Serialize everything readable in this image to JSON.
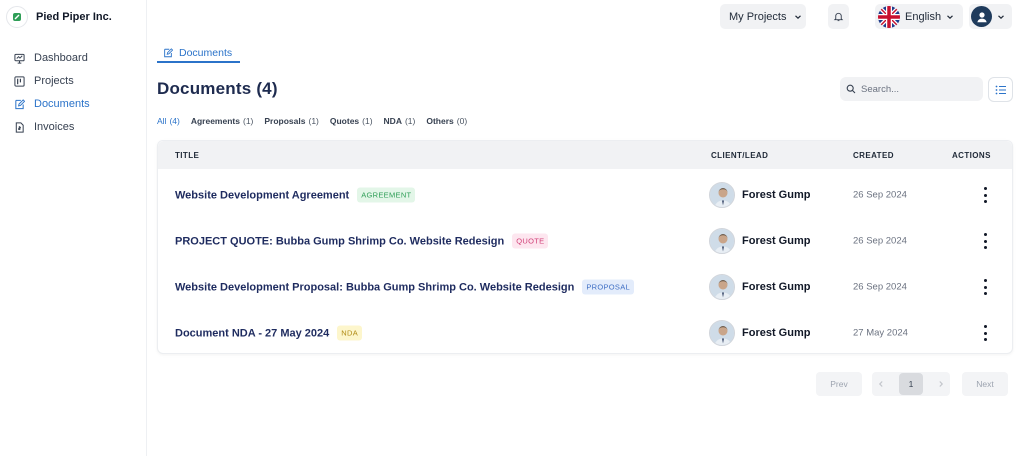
{
  "brand": {
    "name": "Pied Piper Inc."
  },
  "nav": [
    {
      "label": "Dashboard",
      "icon": "dashboard-icon"
    },
    {
      "label": "Projects",
      "icon": "projects-icon"
    },
    {
      "label": "Documents",
      "icon": "documents-icon",
      "active": true
    },
    {
      "label": "Invoices",
      "icon": "invoices-icon"
    }
  ],
  "header": {
    "projects_label": "My Projects",
    "language": "English"
  },
  "tab": {
    "label": "Documents"
  },
  "page": {
    "title": "Documents",
    "count": "(4)"
  },
  "search": {
    "placeholder": "Search..."
  },
  "filters": [
    {
      "label": "All",
      "count": "(4)",
      "active": true
    },
    {
      "label": "Agreements",
      "count": "(1)"
    },
    {
      "label": "Proposals",
      "count": "(1)"
    },
    {
      "label": "Quotes",
      "count": "(1)"
    },
    {
      "label": "NDA",
      "count": "(1)"
    },
    {
      "label": "Others",
      "count": "(0)"
    }
  ],
  "table": {
    "columns": {
      "title": "TITLE",
      "client": "CLIENT/LEAD",
      "created": "CREATED",
      "actions": "ACTIONS"
    },
    "rows": [
      {
        "title": "Website Development Agreement",
        "badge": "AGREEMENT",
        "client": "Forest Gump",
        "created": "26 Sep 2024"
      },
      {
        "title": "PROJECT QUOTE: Bubba Gump Shrimp Co. Website Redesign",
        "badge": "QUOTE",
        "client": "Forest Gump",
        "created": "26 Sep 2024"
      },
      {
        "title": "Website Development Proposal: Bubba Gump Shrimp Co. Website Redesign",
        "badge": "PROPOSAL",
        "client": "Forest Gump",
        "created": "26 Sep 2024"
      },
      {
        "title": "Document NDA - 27 May 2024",
        "badge": "NDA",
        "client": "Forest Gump",
        "created": "27 May 2024"
      }
    ]
  },
  "pagination": {
    "prev": "Prev",
    "page": "1",
    "next": "Next"
  },
  "colors": {
    "accent": "#2b73c9",
    "title_navy": "#1e2b4f"
  }
}
